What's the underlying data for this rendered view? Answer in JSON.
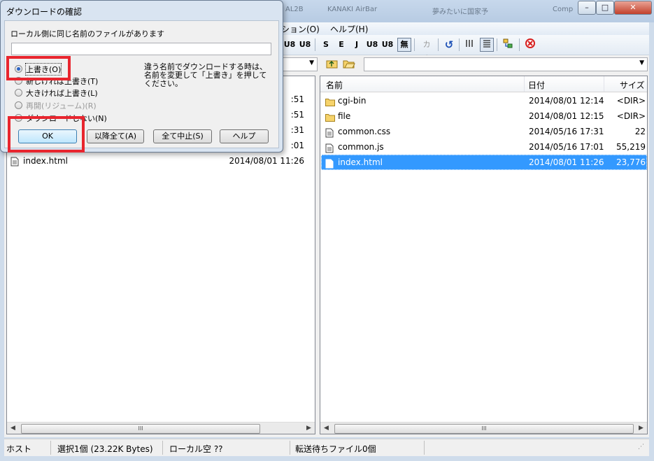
{
  "window": {
    "tabs": [
      "ダウンロードの確認",
      "AL2B",
      "KANAKI AirBar",
      "夢みたいに国家予",
      "Comp"
    ]
  },
  "menu": {
    "items": [
      "ション(O)",
      "ヘルプ(H)"
    ]
  },
  "toolbar": {
    "buttons": [
      "U8",
      "U8",
      "S",
      "E",
      "J",
      "U8",
      "U8",
      "無",
      "カナ"
    ]
  },
  "left_pane": {
    "rows": [
      {
        "name": "",
        "date": ":51"
      },
      {
        "name": "",
        "date": ":51"
      },
      {
        "name": "",
        "date": ":31"
      },
      {
        "name": "",
        "date": ":01"
      },
      {
        "name": "index.html",
        "date": "2014/08/01 11:26"
      }
    ],
    "scroll_thumb": "III"
  },
  "right_pane": {
    "headers": {
      "name": "名前",
      "date": "日付",
      "size": "サイズ"
    },
    "rows": [
      {
        "icon": "folder-icon",
        "name": "cgi-bin",
        "date": "2014/08/01 12:14",
        "size": "<DIR>"
      },
      {
        "icon": "folder-icon",
        "name": "file",
        "date": "2014/08/01 12:15",
        "size": "<DIR>"
      },
      {
        "icon": "document-icon",
        "name": "common.css",
        "date": "2014/05/16 17:31",
        "size": "22"
      },
      {
        "icon": "document-icon",
        "name": "common.js",
        "date": "2014/05/16 17:01",
        "size": "55,219"
      },
      {
        "icon": "document-icon",
        "name": "index.html",
        "date": "2014/08/01 11:26",
        "size": "23,776",
        "selected": true
      }
    ],
    "scroll_thumb": "III"
  },
  "statusbar": {
    "host": "ホスト",
    "selection": "選択1個 (23.22K Bytes)",
    "local": "ローカル空 ??",
    "queue": "転送待ちファイル0個"
  },
  "dialog": {
    "title": "ダウンロードの確認",
    "message": "ローカル側に同じ名前のファイルがあります",
    "filename_value": "",
    "options": [
      {
        "label": "上書き(O)",
        "checked": true,
        "enabled": true
      },
      {
        "label": "新しければ上書き(T)",
        "checked": false,
        "enabled": true
      },
      {
        "label": "大きければ上書き(L)",
        "checked": false,
        "enabled": true
      },
      {
        "label": "再開(リジューム)(R)",
        "checked": false,
        "enabled": false
      },
      {
        "label": "ダウンロードしない(N)",
        "checked": false,
        "enabled": true
      }
    ],
    "hint": "違う名前でダウンロードする時は、名前を変更して「上書き」を押してください。",
    "buttons": {
      "ok": "OK",
      "apply_all": "以降全て(A)",
      "abort_all": "全て中止(S)",
      "help": "ヘルプ"
    }
  },
  "colors": {
    "selection": "#3399ff",
    "highlight": "#e8252e"
  }
}
